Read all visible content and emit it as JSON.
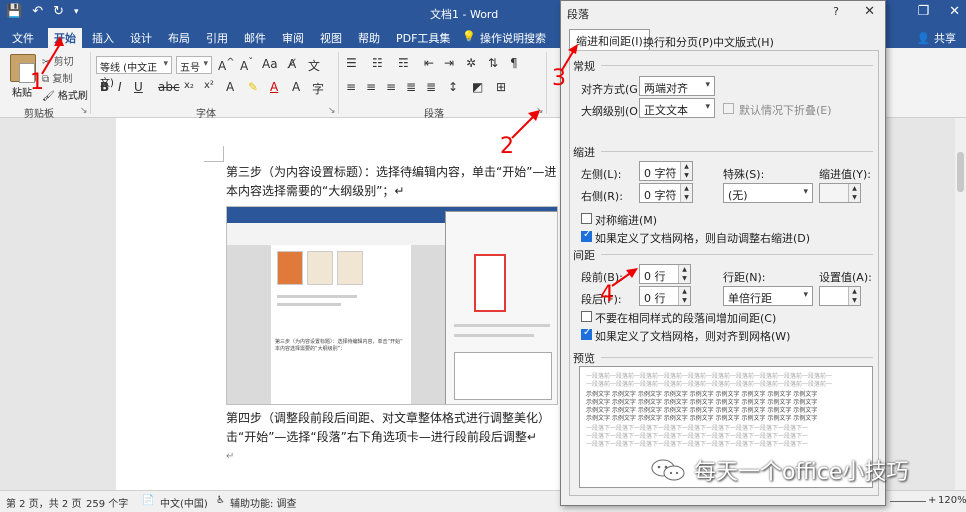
{
  "titlebar": {
    "doc_title": "文档1 - Word",
    "qat_icons": [
      "save-icon",
      "undo-icon",
      "redo-icon"
    ]
  },
  "menu": {
    "tabs": [
      "文件",
      "开始",
      "插入",
      "设计",
      "布局",
      "引用",
      "邮件",
      "审阅",
      "视图",
      "帮助",
      "PDF工具集",
      "操作说明搜索"
    ],
    "active": "开始",
    "share": "共享"
  },
  "ribbon": {
    "paste": "粘贴",
    "cut": "剪切",
    "copy": "复制",
    "format_painter": "格式刷",
    "clipboard_label": "剪贴板",
    "font_name": "等线 (中文正文)",
    "font_size": "五号",
    "font_label": "字体",
    "paragraph_label": "段落"
  },
  "document": {
    "para1_line1": "第三步（为内容设置标题）：选择待编辑内容，单击“开始”—进",
    "para1_line2": "本内容选择需要的“大纲级别”；↵",
    "para2_line1": "第四步（调整段前段后间距、对文章整体格式进行调整美化）",
    "para2_line2": "击“开始”—选择“段落”右下角选项卡—进行段前段后调整↵",
    "para3": "↵",
    "embedded_caption_1": "第三步（为内容设置标题）：选择待编辑内容，单击“开始”",
    "embedded_caption_2": "本内容选择需要的“大纲级别”："
  },
  "statusbar": {
    "page": "第 2 页，共 2 页",
    "words": "259 个字",
    "lang": "中文(中国)",
    "accessibility": "辅助功能: 调查",
    "zoom": "120%"
  },
  "dialog": {
    "title": "段落",
    "help": "?",
    "tabs": [
      "缩进和间距(I)",
      "换行和分页(P)",
      "中文版式(H)"
    ],
    "general": {
      "section": "常规",
      "align_label": "对齐方式(G):",
      "align_value": "两端对齐",
      "outline_label": "大纲级别(O):",
      "outline_value": "正文文本",
      "collapse_label": "默认情况下折叠(E)"
    },
    "indent": {
      "section": "缩进",
      "left_label": "左侧(L):",
      "left_value": "0 字符",
      "right_label": "右侧(R):",
      "right_value": "0 字符",
      "special_label": "特殊(S):",
      "special_value": "(无)",
      "by_label": "缩进值(Y):",
      "mirror_label": "对称缩进(M)",
      "grid_label": "如果定义了文档网格，则自动调整右缩进(D)"
    },
    "spacing": {
      "section": "间距",
      "before_label": "段前(B):",
      "before_value": "0 行",
      "after_label": "段后(F):",
      "after_value": "0 行",
      "line_label": "行距(N):",
      "line_value": "单倍行距",
      "at_label": "设置值(A):",
      "no_space_label": "不要在相同样式的段落间增加间距(C)",
      "snap_label": "如果定义了文档网格，则对齐到网格(W)"
    },
    "preview": {
      "section": "预览",
      "prev_text": "一段落前一段落前一段落前一段落前一段落前一段落前一段落前一段落前一段落前一段落前一",
      "sample_text": "示例文字 示例文字 示例文字 示例文字 示例文字 示例文字 示例文字 示例文字 示例文字",
      "next_text": "一段落下一段落下一段落下一段落下一段落下一段落下一段落下一段落下一段落下一"
    }
  },
  "annotations": [
    "1",
    "2",
    "3",
    "4"
  ],
  "watermark": "每天一个office小技巧",
  "colors": {
    "brand": "#2b579a",
    "annotation": "#e00000",
    "checkbox": "#1e6fd9"
  }
}
